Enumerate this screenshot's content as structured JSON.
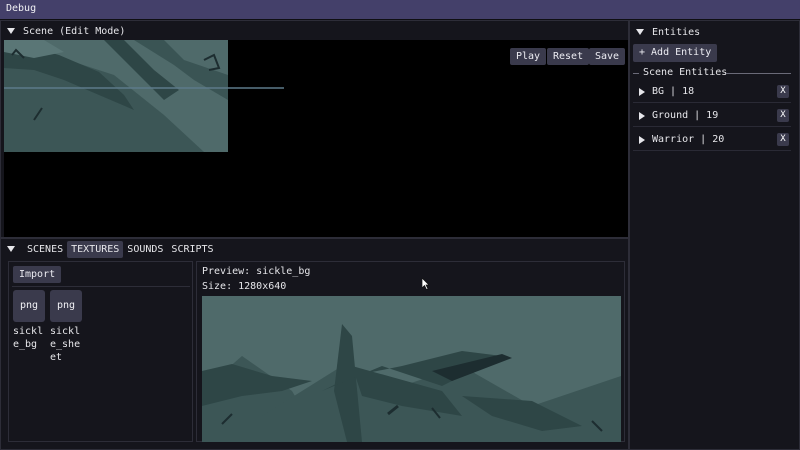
{
  "window": {
    "title": "Debug"
  },
  "scene": {
    "title": "Scene (Edit Mode)",
    "play_label": "Play",
    "reset_label": "Reset",
    "save_label": "Save"
  },
  "bottom": {
    "tabs": [
      "SCENES",
      "TEXTURES",
      "SOUNDS",
      "SCRIPTS"
    ],
    "active_tab": "TEXTURES",
    "import_label": "Import",
    "assets": [
      {
        "type": "png",
        "name": "sickle_bg"
      },
      {
        "type": "png",
        "name": "sickle_sheet"
      }
    ],
    "preview_label": "Preview: sickle_bg",
    "size_label": "Size: 1280x640"
  },
  "entities": {
    "title": "Entities",
    "add_label": "+ Add Entity",
    "section_label": "Scene Entities",
    "remove_label": "X",
    "items": [
      {
        "label": "BG | 18"
      },
      {
        "label": "Ground | 19"
      },
      {
        "label": "Warrior | 20"
      }
    ]
  },
  "colors": {
    "titlebar": "#44406a",
    "button": "#3a3a4c",
    "sky": "#4f6a6a",
    "mountain": "#2e4646",
    "shadow": "#1d2d30"
  },
  "icons": [
    "collapse-triangle-icon",
    "expand-arrow-icon",
    "mouse-cursor-icon"
  ]
}
